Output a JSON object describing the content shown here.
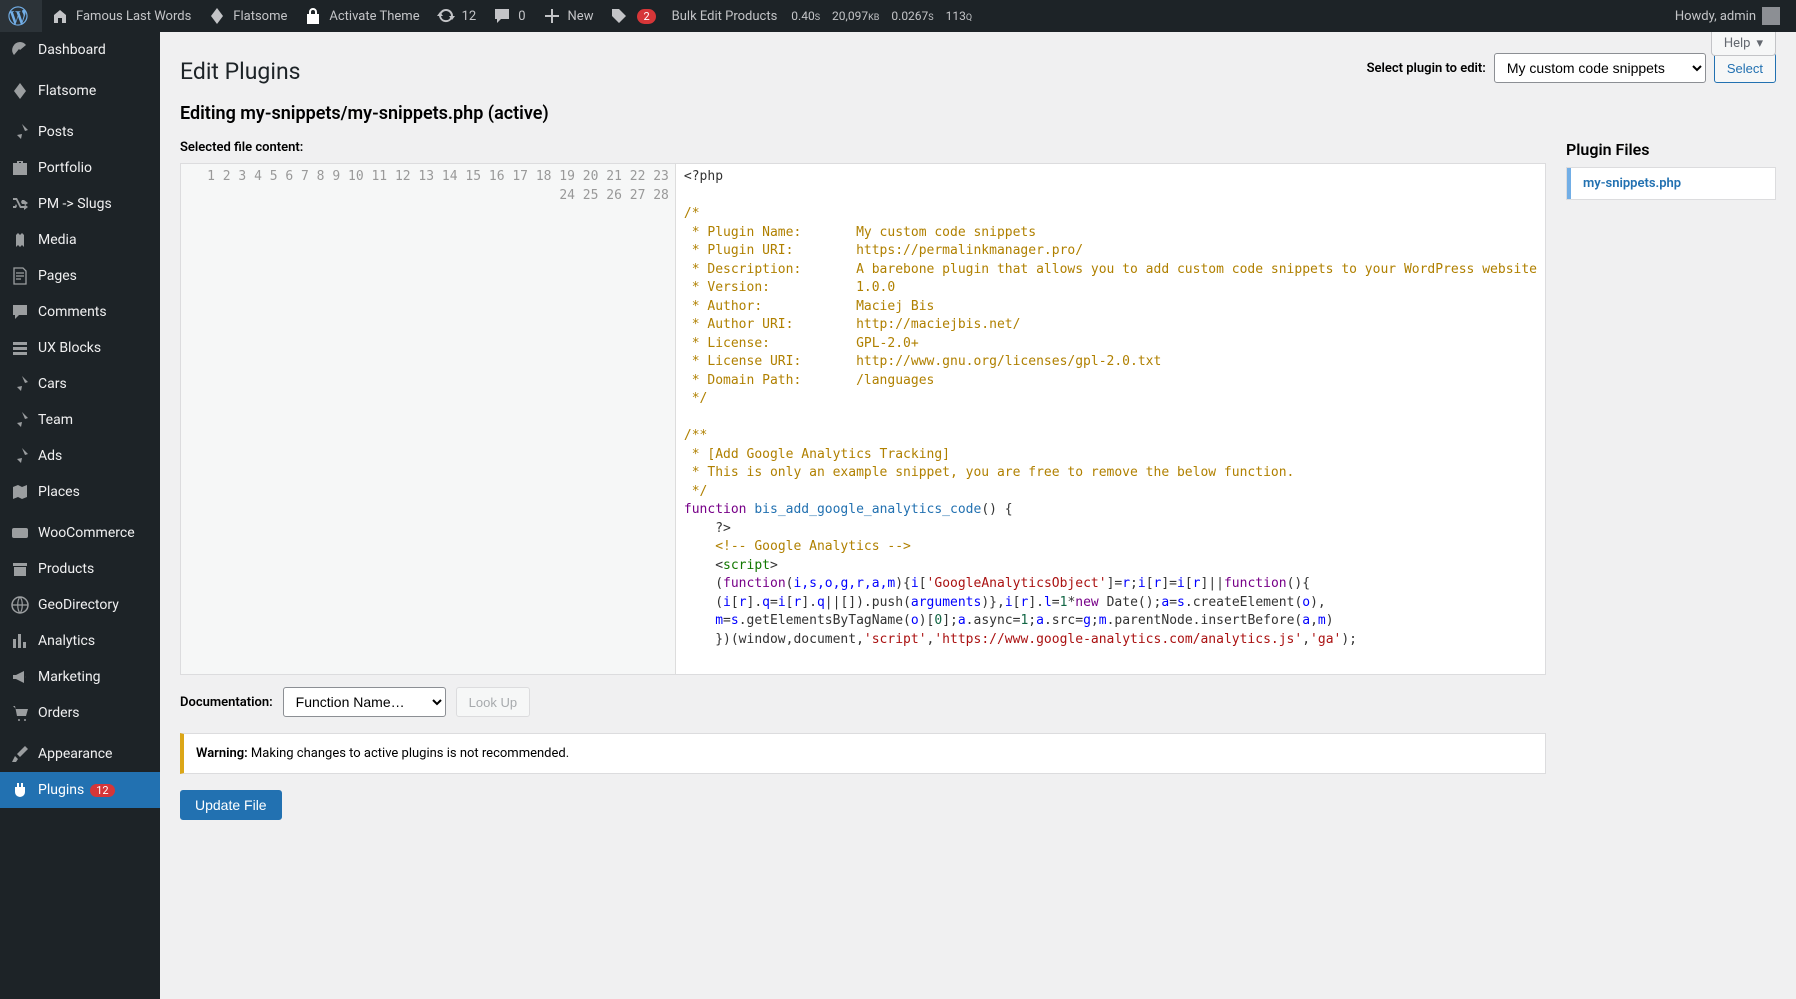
{
  "toolbar": {
    "site_title": "Famous Last Words",
    "flatsome_label": "Flatsome",
    "activate_theme": "Activate Theme",
    "updates_count": "12",
    "comments_count": "0",
    "new_label": "New",
    "notif_count": "2",
    "bulk_edit": "Bulk Edit Products",
    "debug_time": "0.40",
    "debug_time_unit": "S",
    "debug_mem": "20,097",
    "debug_mem_unit": "KB",
    "debug_time2": "0.0267",
    "debug_time2_unit": "S",
    "debug_queries": "113",
    "debug_queries_unit": "Q",
    "howdy": "Howdy, admin"
  },
  "sidebar": {
    "items": [
      {
        "label": "Dashboard"
      },
      {
        "label": "Flatsome"
      },
      {
        "label": "Posts"
      },
      {
        "label": "Portfolio"
      },
      {
        "label": "PM -> Slugs"
      },
      {
        "label": "Media"
      },
      {
        "label": "Pages"
      },
      {
        "label": "Comments"
      },
      {
        "label": "UX Blocks"
      },
      {
        "label": "Cars"
      },
      {
        "label": "Team"
      },
      {
        "label": "Ads"
      },
      {
        "label": "Places"
      },
      {
        "label": "WooCommerce"
      },
      {
        "label": "Products"
      },
      {
        "label": "GeoDirectory"
      },
      {
        "label": "Analytics"
      },
      {
        "label": "Marketing"
      },
      {
        "label": "Orders"
      },
      {
        "label": "Appearance"
      },
      {
        "label": "Plugins",
        "badge": "12"
      }
    ]
  },
  "main": {
    "help_label": "Help",
    "h1": "Edit Plugins",
    "subtitle": "Editing my-snippets/my-snippets.php (active)",
    "select_plugin_label": "Select plugin to edit:",
    "plugin_selected": "My custom code snippets",
    "select_button": "Select",
    "selected_file_label": "Selected file content:",
    "plugin_files_heading": "Plugin Files",
    "file_name": "my-snippets.php",
    "doc_label": "Documentation:",
    "doc_select": "Function Name…",
    "lookup_label": "Look Up",
    "warning_strong": "Warning:",
    "warning_text": " Making changes to active plugins is not recommended.",
    "update_label": "Update File"
  },
  "code": {
    "lines": 28,
    "l1": "<?php",
    "l3": "/*",
    "l4": " * Plugin Name:       My custom code snippets",
    "l5": " * Plugin URI:        https://permalinkmanager.pro/",
    "l6": " * Description:       A barebone plugin that allows you to add custom code snippets to your WordPress website",
    "l7": " * Version:           1.0.0",
    "l8": " * Author:            Maciej Bis",
    "l9": " * Author URI:        http://maciejbis.net/",
    "l10": " * License:           GPL-2.0+",
    "l11": " * License URI:       http://www.gnu.org/licenses/gpl-2.0.txt",
    "l12": " * Domain Path:       /languages",
    "l13": " */",
    "l15": "/**",
    "l16": " * [Add Google Analytics Tracking]",
    "l17": " * This is only an example snippet, you are free to remove the below function.",
    "l18": " */",
    "kw_function": "function",
    "fn_name": "bis_add_google_analytics_code",
    "l19_tail": "() {",
    "l20": "    ?>",
    "l21a": "    ",
    "l21b": "<!-- Google Analytics -->",
    "l22a": "    <",
    "l22b": "script",
    "l22c": ">",
    "l23a": "    (",
    "l23_fn": "function",
    "l23b": "(",
    "l23_args": "i,s,o,g,r,a,m",
    "l23c": "){",
    "l23d": "i",
    "l23e": "[",
    "l23_str1": "'GoogleAnalyticsObject'",
    "l23f": "]=",
    "l23g": "r",
    "l23h": ";",
    "l23i": "i",
    "l23j": "[",
    "l23k": "r",
    "l23l": "]=",
    "l23m": "i",
    "l23n": "[",
    "l23o": "r",
    "l23p": "]||",
    "l23q": "function",
    "l23r": "(){",
    "l24a": "    (",
    "l24b": "i",
    "l24c": "[",
    "l24d": "r",
    "l24e": "].",
    "l24f": "q",
    "l24g": "=",
    "l24h": "i",
    "l24i": "[",
    "l24j": "r",
    "l24k": "].",
    "l24l": "q",
    "l24m": "||[]).push(",
    "l24_arg": "arguments",
    "l24n": ")},",
    "l24o": "i",
    "l24p": "[",
    "l24q": "r",
    "l24r": "].",
    "l24s": "l",
    "l24t": "=",
    "l24_one": "1",
    "l24u": "*",
    "l24_new": "new",
    "l24v": " Date();",
    "l24w": "a",
    "l24x": "=",
    "l24y": "s",
    "l24z": ".createElement(",
    "l24aa": "o",
    "l24ab": "),",
    "l25a": "    ",
    "l25b": "m",
    "l25c": "=",
    "l25d": "s",
    "l25e": ".getElementsByTagName(",
    "l25f": "o",
    "l25g": ")[",
    "l25_zero": "0",
    "l25h": "];",
    "l25i": "a",
    "l25j": ".async=",
    "l25_one": "1",
    "l25k": ";",
    "l25l": "a",
    "l25m": ".src=",
    "l25n": "g",
    "l25o": ";",
    "l25p": "m",
    "l25q": ".parentNode.insertBefore(",
    "l25r": "a",
    "l25s": ",",
    "l25t": "m",
    "l25u": ")",
    "l26a": "    })(window,document,",
    "l26_s1": "'script'",
    "l26b": ",",
    "l26_s2": "'https://www.google-analytics.com/analytics.js'",
    "l26c": ",",
    "l26_s3": "'ga'",
    "l26d": ");"
  }
}
